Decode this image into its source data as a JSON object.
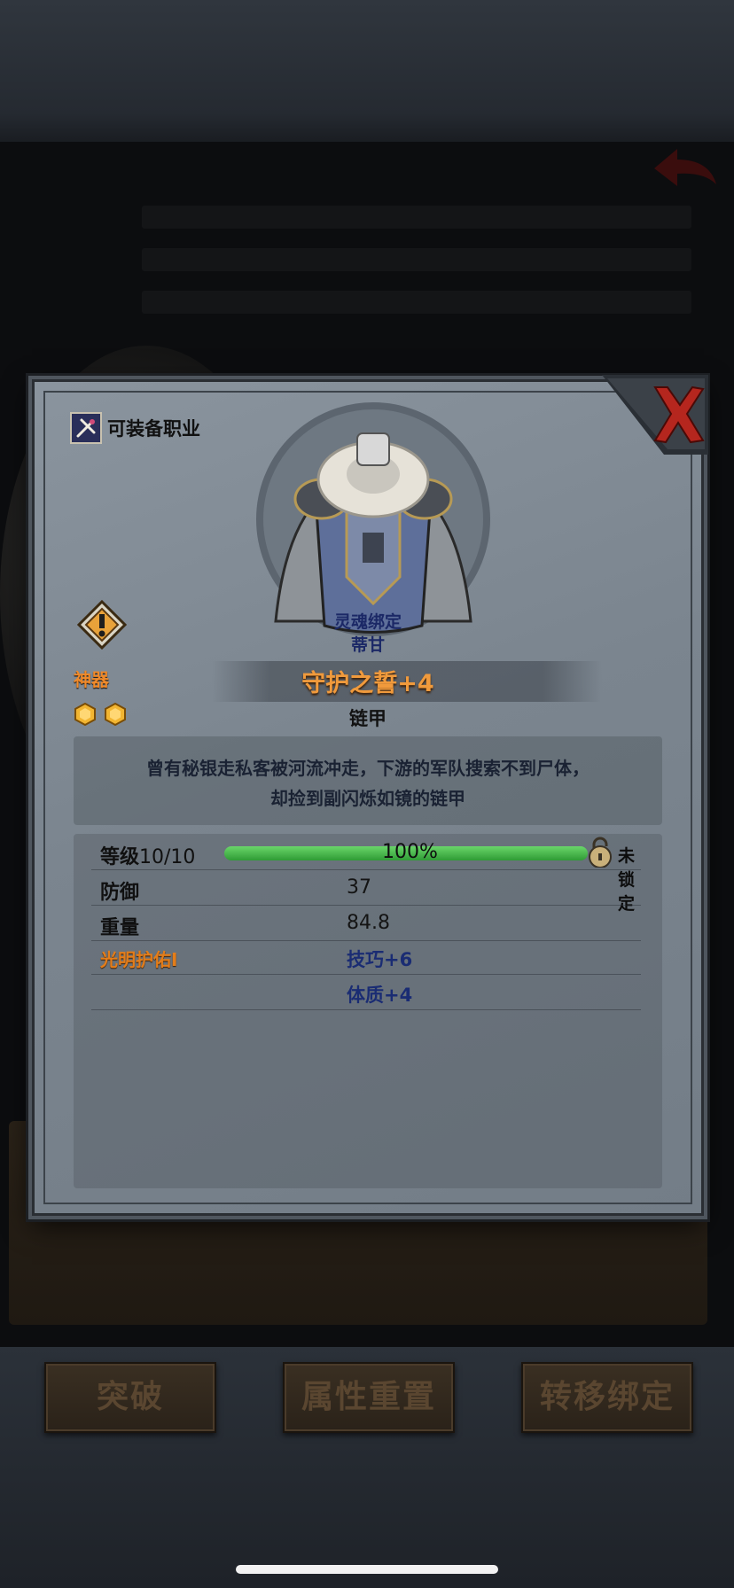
{
  "item": {
    "job_label": "可装备职业",
    "binding": "灵魂绑定",
    "owner": "蒂甘",
    "rarity": "神器",
    "name": "守护之誓+4",
    "type": "链甲",
    "description_line1": "曾有秘银走私客被河流冲走，下游的军队搜索不到尸体，",
    "description_line2": "却捡到副闪烁如镜的链甲",
    "star_count": 2
  },
  "stats": {
    "level_label": "等级",
    "level_value": "10/10",
    "level_percent_text": "100%",
    "level_fraction": 1.0,
    "lock_label": "未锁定",
    "rows": [
      {
        "name": "防御",
        "value": "37"
      },
      {
        "name": "重量",
        "value": "84.8"
      }
    ],
    "enchant_name": "光明护佑I",
    "enchant_bonuses": [
      "技巧+6",
      "体质+4"
    ]
  },
  "buttons": {
    "breakthrough": "突破",
    "reset_attributes": "属性重置",
    "transfer_binding": "转移绑定"
  },
  "colors": {
    "rarity_orange": "#f08a2a",
    "bonus_blue": "#1a2c73",
    "progress_green": "#3fb346"
  },
  "icons": [
    "back-arrow-icon",
    "close-icon",
    "job-class-icon",
    "artifact-upgrade-icon",
    "star-gem-icon",
    "lock-icon"
  ]
}
